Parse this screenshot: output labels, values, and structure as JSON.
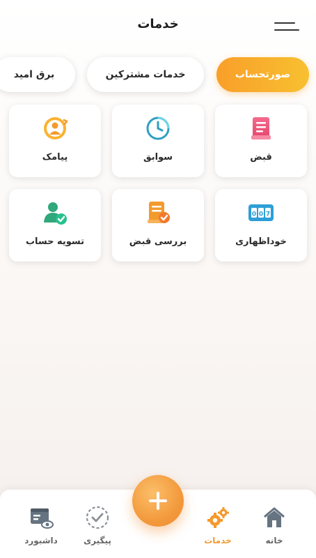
{
  "header": {
    "title": "خدمات"
  },
  "tabs": [
    {
      "label": "صورتحساب",
      "active": true
    },
    {
      "label": "خدمات مشترکین",
      "active": false
    },
    {
      "label": "برق امید",
      "active": false
    }
  ],
  "services": [
    {
      "label": "قبض",
      "icon": "bill-icon"
    },
    {
      "label": "سوابق",
      "icon": "clock-history-icon"
    },
    {
      "label": "پیامک",
      "icon": "sms-user-icon"
    },
    {
      "label": "خوداظهاری",
      "icon": "meter-counter-icon"
    },
    {
      "label": "بررسی قبض",
      "icon": "bill-check-icon"
    },
    {
      "label": "تسویه حساب",
      "icon": "user-check-icon"
    }
  ],
  "bottom_nav": {
    "home": "خانه",
    "services": "خدمات",
    "tracking": "پیگیری",
    "dashboard": "داشبورد"
  },
  "colors": {
    "accent": "#f39a2e",
    "accent_light": "#f8c030",
    "text": "#2a2a2a"
  }
}
